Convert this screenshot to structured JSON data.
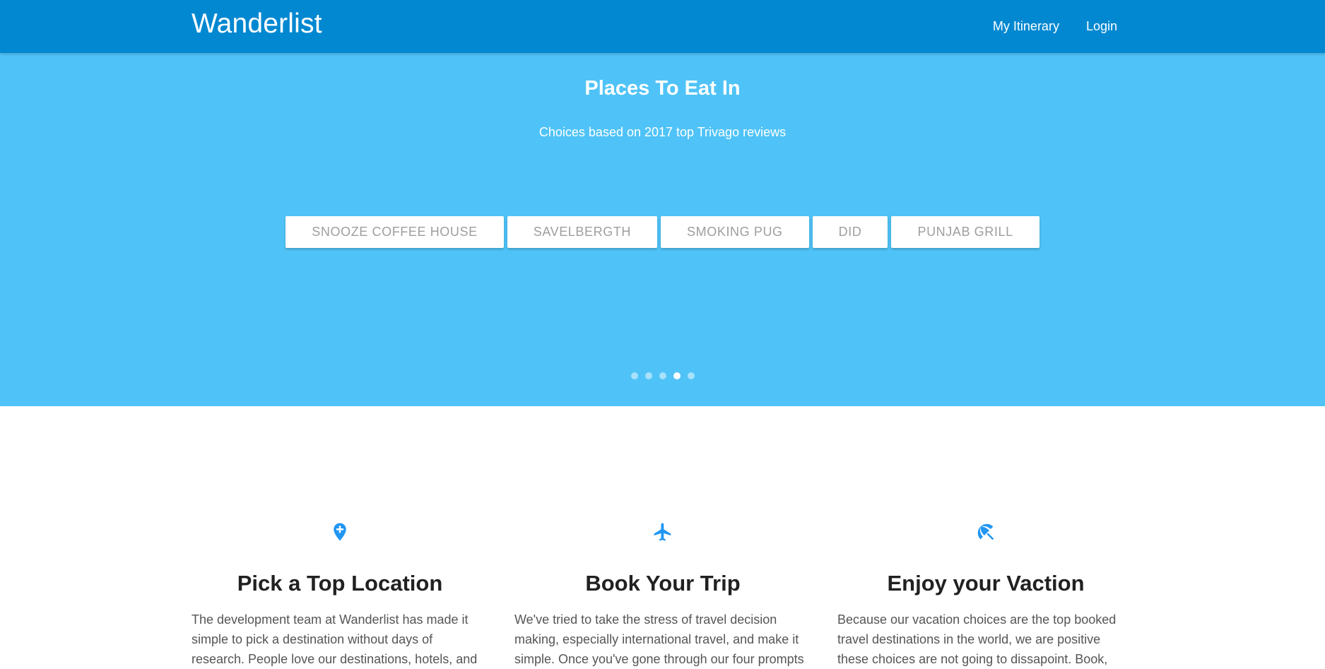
{
  "navbar": {
    "brand": "Wanderlist",
    "links": [
      "My Itinerary",
      "Login"
    ]
  },
  "hero": {
    "title": "Places To Eat In",
    "subtitle": "Choices based on 2017 top Trivago reviews",
    "chips": [
      "SNOOZE COFFEE HOUSE",
      "SAVELBERGTH",
      "SMOKING PUG",
      "DID",
      "PUNJAB GRILL"
    ],
    "carousel": {
      "slide_count": 5,
      "active_slide": 4
    }
  },
  "features": [
    {
      "icon": "add-location-icon",
      "title": "Pick a Top Location",
      "text": "The development team at Wanderlist has made it simple to pick a destination without days of research. People love our destinations, hotels, and"
    },
    {
      "icon": "airplane-icon",
      "title": "Book Your Trip",
      "text": "We've tried to take the stress of travel decision making, especially international travel, and make it simple. Once you've gone through our four prompts"
    },
    {
      "icon": "beach-umbrella-icon",
      "title": "Enjoy your Vaction",
      "text": "Because our vacation choices are the top booked travel destinations in the world, we are positive these choices are not going to dissapoint. Book,"
    }
  ],
  "colors": {
    "navbar": "#0288d1",
    "hero": "#4fc3f7",
    "icon_accent": "#2196f3",
    "chip_text": "#9e9e9e"
  }
}
